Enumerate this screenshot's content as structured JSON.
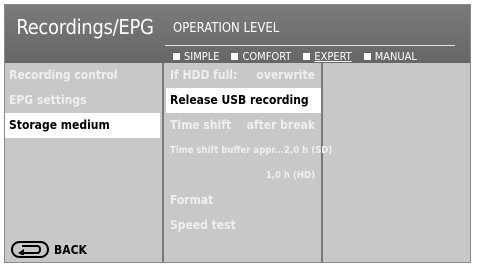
{
  "header": {
    "title": "Recordings/EPG",
    "operation_level_title": "Operation level",
    "levels": [
      {
        "label": "SIMPLE",
        "active": false
      },
      {
        "label": "COMFORT",
        "active": false
      },
      {
        "label": "EXPERT",
        "active": true
      },
      {
        "label": "MANUAL",
        "active": false
      }
    ]
  },
  "menu": {
    "items": [
      {
        "label": "Recording control",
        "selected": false
      },
      {
        "label": "EPG settings",
        "selected": false
      },
      {
        "label": "Storage medium",
        "selected": true
      }
    ]
  },
  "submenu": {
    "if_hdd_full": {
      "label": "If HDD full:",
      "value": "overwrite"
    },
    "release_usb": {
      "label": "Release USB recording"
    },
    "time_shift": {
      "label": "Time shift",
      "value": "after break"
    },
    "buffer": {
      "label": "Time shift buffer appr...",
      "value_sd": "2,0 h (SD)",
      "value_hd": "1,0 h (HD)"
    },
    "format": {
      "label": "Format"
    },
    "speed_test": {
      "label": "Speed test"
    }
  },
  "footer": {
    "back_label": "BACK",
    "back_icon": "return-arrow-icon"
  },
  "colors": {
    "background": "#c8c8c8",
    "header": "#707070",
    "selected_bg": "#ffffff"
  }
}
